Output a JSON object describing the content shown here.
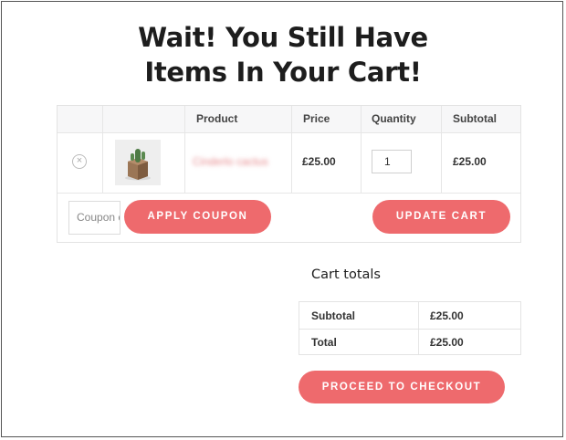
{
  "headline": {
    "line1": "Wait! You Still Have",
    "line2": "Items In Your Cart!"
  },
  "cart_table": {
    "columns": [
      "Product",
      "Price",
      "Quantity",
      "Subtotal"
    ],
    "rows": [
      {
        "remove_icon": "close-icon",
        "product_name": "Cinderlo cactus",
        "price": "£25.00",
        "quantity": "1",
        "subtotal": "£25.00"
      }
    ],
    "coupon_placeholder": "Coupon code",
    "apply_coupon_label": "APPLY COUPON",
    "update_cart_label": "UPDATE CART"
  },
  "totals": {
    "title": "Cart totals",
    "rows": [
      {
        "label": "Subtotal",
        "value": "£25.00"
      },
      {
        "label": "Total",
        "value": "£25.00"
      }
    ],
    "checkout_label": "PROCEED TO CHECKOUT"
  },
  "colors": {
    "accent": "#ee6a6d",
    "header_bg": "#f7f7f8",
    "border": "#e3e3e3"
  }
}
